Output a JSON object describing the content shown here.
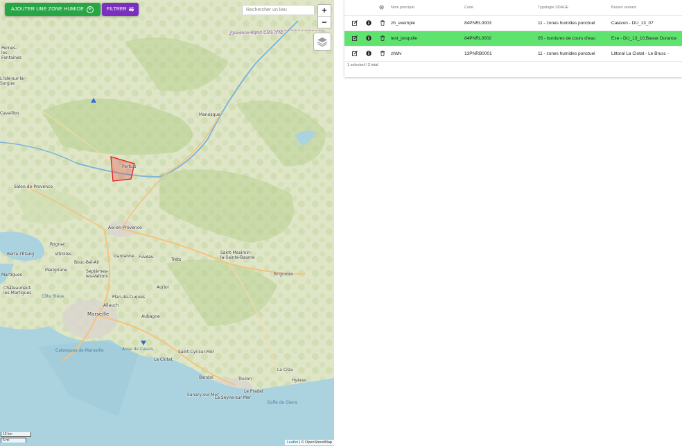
{
  "map": {
    "add_zone_label": "AJOUTER UNE ZONE HUMIDE",
    "filter_label": "FILTRER",
    "search_placeholder": "Rechercher un lieu",
    "zoom_in": "+",
    "zoom_out": "−",
    "scale_km": "10 km",
    "scale_mi": "5 mi",
    "attribution_link": "Leaflet",
    "attribution_text": "| © OpenStreetMap",
    "places": {
      "provence": "Provence-Alpes-Côte d'Az",
      "pernes": "Pernes-les-Fontaines",
      "isle": "L'Isle-sur-la-Sorgue",
      "cavaillon": "Cavaillon",
      "manosque": "Manosque",
      "pertuis": "Pertuis",
      "salon": "Salon-de-Provence",
      "aix": "Aix-en-Provence",
      "berre": "Berre-l'Étang",
      "vitrolles": "Vitrolles",
      "marignane": "Marignane",
      "rognac": "Rognac",
      "martigues": "Martigues",
      "bouc": "Bouc-Bel-Air",
      "septemes": "Septèmes-les-Vallons",
      "gardanne": "Gardanne",
      "fuveau": "Fuveau",
      "trets": "Trets",
      "saintmax": "Saint-Maximin-la-Sainte-Baume",
      "brignoles": "Brignoles",
      "auriol": "Auriol",
      "plan": "Plan-de-Cuques",
      "allauch": "Allauch",
      "chateauneuf": "Châteauneuf-les-Martigues",
      "cote": "Côte Bleue",
      "marseille": "Marseille",
      "aubagne": "Aubagne",
      "ciotat": "La Ciotat",
      "cyr": "Saint-Cyr-sur-Mer",
      "bandol": "Bandol",
      "sanary": "Sanary-sur-Mer",
      "toulon": "Toulon",
      "seyne": "La Seyne-sur-Mer",
      "crau": "La Crau",
      "hyeres": "Hyères",
      "calanques": "Calanques de Marseille",
      "pradet": "Le Pradet",
      "giens": "Golfe de Giens",
      "cassis": "Anse de Cassis"
    }
  },
  "table": {
    "headers": [
      "",
      "",
      "",
      "Nom principal",
      "Code",
      "Typologie SDAGE",
      "Bassin versant"
    ],
    "rows": [
      {
        "nom": "zh_exemple",
        "code": "84PNRL0003",
        "typologie": "11 - zones humides ponctuel",
        "bassin": "Calavon - DU_13_07",
        "selected": false
      },
      {
        "nom": "test_jonquille",
        "code": "84PNRL0002",
        "typologie": "05 - bordures de cours d'eau",
        "bassin": "Eze - DU_13_10,Basse Durance",
        "selected": true
      },
      {
        "nom": "zhMv",
        "code": "13PNRB0001",
        "typologie": "11 - zones humides ponctuel",
        "bassin": "Littoral La Ciotat - Le Brusc -",
        "selected": false
      }
    ],
    "footer": "1 selected / 3 total"
  },
  "colors": {
    "add_button": "#27a646",
    "filter_button": "#7b2fbe",
    "selected_row": "#5ee36e",
    "polygon": "#e8191f"
  },
  "icons": {
    "edit": "edit-icon",
    "info": "info-icon",
    "delete": "trash-icon",
    "settings": "gear-icon",
    "layers": "layers-icon",
    "marker": "map-marker-icon"
  }
}
